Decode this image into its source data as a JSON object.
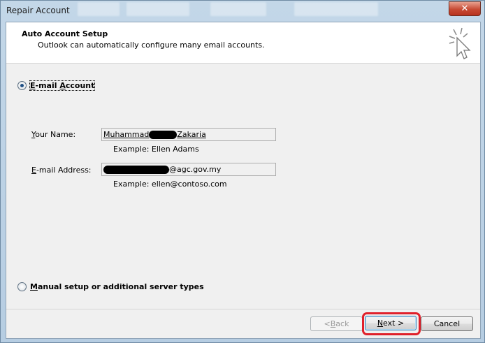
{
  "window": {
    "title": "Repair Account",
    "close_label": "✕"
  },
  "header": {
    "title": "Auto Account Setup",
    "subtitle": "Outlook can automatically configure many email accounts."
  },
  "email_account_option": {
    "label_prefix": "",
    "label_underlined": "E",
    "label_rest": "-mail ",
    "label_underlined2": "A",
    "label_end": "ccount",
    "selected": true
  },
  "name_field": {
    "label_underlined": "Y",
    "label_rest": "our Name:",
    "value_start": "Muhammad",
    "value_end": "Zakaria",
    "example": "Example: Ellen Adams"
  },
  "email_field": {
    "label_underlined": "E",
    "label_rest": "-mail Address:",
    "value_end": "@agc.gov.my",
    "example": "Example: ellen@contoso.com"
  },
  "manual_option": {
    "label_underlined": "M",
    "label_rest": "anual setup or additional server types",
    "selected": false
  },
  "buttons": {
    "back_prefix": "< ",
    "back_underlined": "B",
    "back_rest": "ack",
    "next_underlined": "N",
    "next_rest": "ext >",
    "cancel": "Cancel"
  },
  "colors": {
    "highlight": "#e0202a",
    "close": "#c74a34"
  }
}
